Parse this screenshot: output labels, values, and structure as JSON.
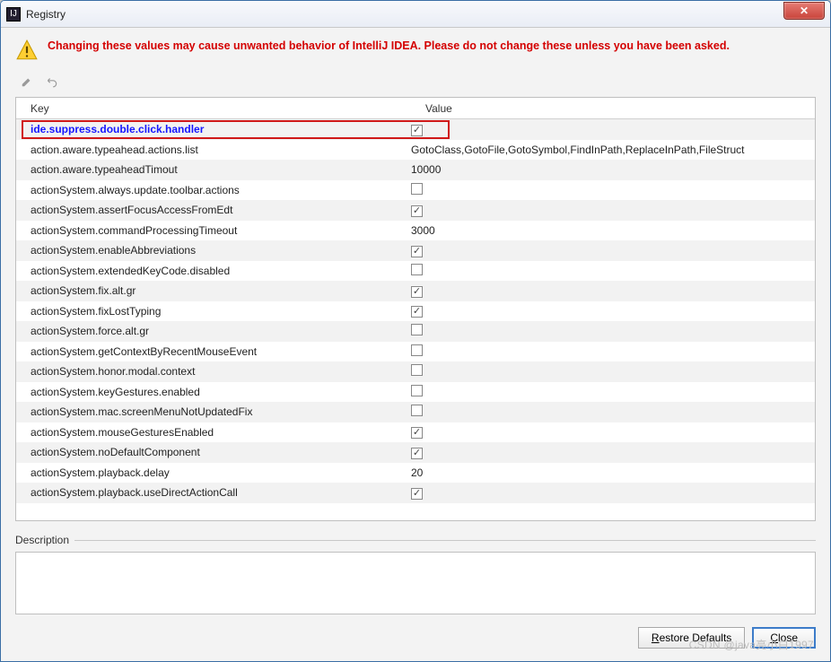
{
  "window": {
    "title": "Registry",
    "app_icon_letter": "IJ"
  },
  "warning": "Changing these values may cause unwanted behavior of IntelliJ IDEA. Please do not change these unless you have been asked.",
  "columns": {
    "key": "Key",
    "value": "Value"
  },
  "rows": [
    {
      "key": "ide.suppress.double.click.handler",
      "type": "check",
      "checked": true,
      "highlight": true
    },
    {
      "key": "action.aware.typeahead.actions.list",
      "type": "text",
      "value": "GotoClass,GotoFile,GotoSymbol,FindInPath,ReplaceInPath,FileStruct"
    },
    {
      "key": "action.aware.typeaheadTimout",
      "type": "text",
      "value": "10000"
    },
    {
      "key": "actionSystem.always.update.toolbar.actions",
      "type": "check",
      "checked": false
    },
    {
      "key": "actionSystem.assertFocusAccessFromEdt",
      "type": "check",
      "checked": true
    },
    {
      "key": "actionSystem.commandProcessingTimeout",
      "type": "text",
      "value": "3000"
    },
    {
      "key": "actionSystem.enableAbbreviations",
      "type": "check",
      "checked": true
    },
    {
      "key": "actionSystem.extendedKeyCode.disabled",
      "type": "check",
      "checked": false
    },
    {
      "key": "actionSystem.fix.alt.gr",
      "type": "check",
      "checked": true
    },
    {
      "key": "actionSystem.fixLostTyping",
      "type": "check",
      "checked": true
    },
    {
      "key": "actionSystem.force.alt.gr",
      "type": "check",
      "checked": false
    },
    {
      "key": "actionSystem.getContextByRecentMouseEvent",
      "type": "check",
      "checked": false
    },
    {
      "key": "actionSystem.honor.modal.context",
      "type": "check",
      "checked": false
    },
    {
      "key": "actionSystem.keyGestures.enabled",
      "type": "check",
      "checked": false
    },
    {
      "key": "actionSystem.mac.screenMenuNotUpdatedFix",
      "type": "check",
      "checked": false
    },
    {
      "key": "actionSystem.mouseGesturesEnabled",
      "type": "check",
      "checked": true
    },
    {
      "key": "actionSystem.noDefaultComponent",
      "type": "check",
      "checked": true
    },
    {
      "key": "actionSystem.playback.delay",
      "type": "text",
      "value": "20"
    },
    {
      "key": "actionSystem.playback.useDirectActionCall",
      "type": "check",
      "checked": true
    }
  ],
  "description_label": "Description",
  "buttons": {
    "restore": "Restore Defaults",
    "close": "Close"
  },
  "watermark": "CSDN @java亮小白1997"
}
